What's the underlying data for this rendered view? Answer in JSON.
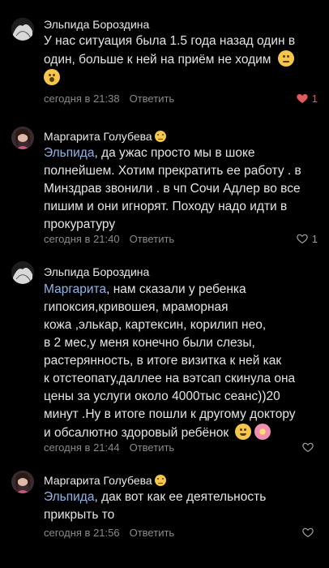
{
  "comments": [
    {
      "author": "Эльпида Бороздина",
      "lines": [
        {
          "text": "У нас ситуация была 1.5 года назад один в"
        },
        {
          "text": "один, больше к ней на приём не ходим"
        },
        {
          "text": ""
        }
      ],
      "time": "сегодня в 21:38",
      "reply_label": "Ответить",
      "likes": "1",
      "liked": true
    },
    {
      "author": "Маргарита Голубева",
      "mention": "Эльпида",
      "lines": [
        {
          "text": ", да ужас просто мы в шоке"
        },
        {
          "text": "полнейшем. Хотим прекратить ее работу . в"
        },
        {
          "text": "Минздрав звонили . в чп Сочи Адлер во все"
        },
        {
          "text": "пишим и они игнорят. Походу надо идти в"
        },
        {
          "text": "прокуратуру"
        }
      ],
      "time": "сегодня в 21:40",
      "reply_label": "Ответить",
      "likes": "1",
      "liked": false
    },
    {
      "author": "Эльпида Бороздина",
      "mention": "Маргарита",
      "lines": [
        {
          "text": ", нам сказали у ребенка"
        },
        {
          "text": "гипоксия,кривошея, мраморная"
        },
        {
          "text": "кожа ,элькар, картексин, корилип нео,"
        },
        {
          "text": "в 2 мес,у меня конечно были слезы,"
        },
        {
          "text": "растерянность, в итоге визитка к ней как"
        },
        {
          "text": "к отстеопату,даллее на вэтсап скинула она"
        },
        {
          "text": "цены за услуги около 4000тыс сеанс))20"
        },
        {
          "text": "минут .Ну в итоге пошли к другому доктору"
        },
        {
          "text": "и обсалютно здоровый ребёнок"
        }
      ],
      "time": "сегодня в 21:44",
      "reply_label": "Ответить",
      "likes": "",
      "liked": false
    },
    {
      "author": "Маргарита Голубева",
      "mention": "Эльпида",
      "lines": [
        {
          "text": ", дак вот как ее деятельность"
        },
        {
          "text": "прикрыть то"
        }
      ],
      "time": "сегодня в 21:56",
      "reply_label": "Ответить",
      "likes": "",
      "liked": false
    }
  ],
  "colors": {
    "background": "#000000",
    "mention": "#8eb6e8",
    "like_active": "#e25a5a",
    "meta": "#8a8a8a"
  },
  "icons": [
    "heart-icon",
    "heart-outline-icon"
  ]
}
